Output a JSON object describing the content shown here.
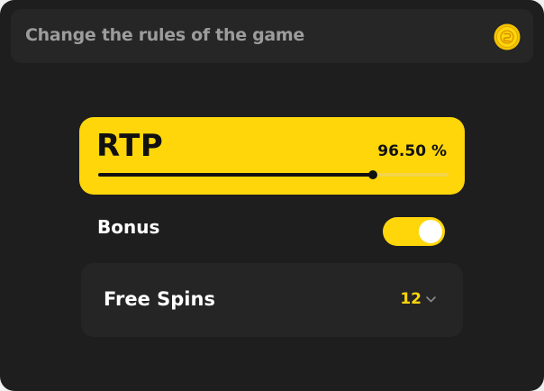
{
  "header": {
    "title": "Change the rules of the game",
    "coin_icon": "coin-icon"
  },
  "rtp": {
    "label": "RTP",
    "value_text": "96.50 %",
    "slider_fraction": 0.785
  },
  "bonus": {
    "label": "Bonus",
    "enabled": true
  },
  "free_spins": {
    "label": "Free Spins",
    "value": "12",
    "dropdown_icon": "chevron-down-icon"
  },
  "colors": {
    "accent": "#ffd60a",
    "panel_background": "#1e1e1e",
    "card_background": "#252525",
    "muted_text": "#9c9c9c"
  }
}
